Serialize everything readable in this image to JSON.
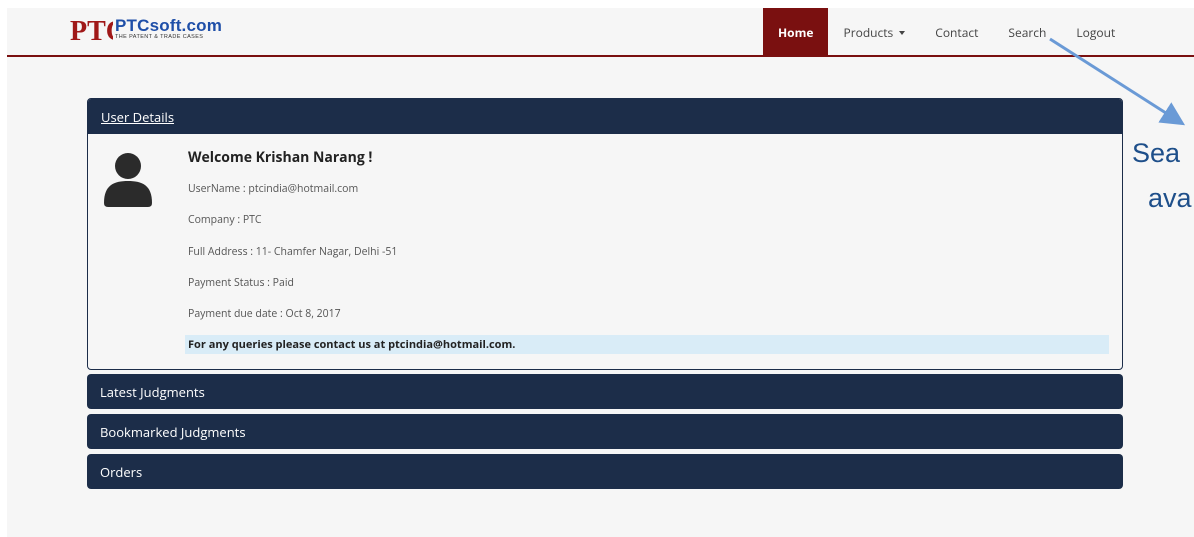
{
  "header": {
    "logo_text": "PTCsoft.com",
    "logo_tagline": "THE PATENT & TRADE CASES",
    "logo_mark": "PTC"
  },
  "nav": {
    "items": [
      {
        "label": "Home",
        "active": true
      },
      {
        "label": "Products",
        "dropdown": true
      },
      {
        "label": "Contact"
      },
      {
        "label": "Search"
      },
      {
        "label": "Logout"
      }
    ]
  },
  "user_details": {
    "heading": "User Details",
    "welcome": "Welcome Krishan Narang !",
    "username": "UserName : ptcindia@hotmail.com",
    "company": "Company : PTC",
    "address": "Full Address : 11- Chamfer Nagar, Delhi -51",
    "payment_status": "Payment Status : Paid",
    "payment_due": "Payment due date : Oct 8, 2017",
    "notice": "For any queries please contact us at ptcindia@hotmail.com."
  },
  "sections": {
    "latest": "Latest Judgments",
    "bookmarked": "Bookmarked Judgments",
    "orders": "Orders"
  },
  "annotation": {
    "line1": "Sea",
    "line2": "ava"
  },
  "colors": {
    "nav_active": "#7a1010",
    "panel_heading": "#1c2d49",
    "notice_bg": "#d9ecf7",
    "annotation": "#1e4f8a",
    "arrow": "#6a9ad6"
  }
}
